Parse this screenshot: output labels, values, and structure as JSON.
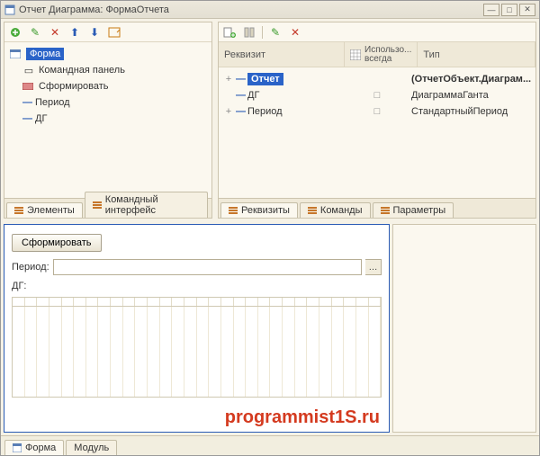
{
  "window": {
    "title": "Отчет Диаграмма: ФормаОтчета"
  },
  "left": {
    "root": "Форма",
    "items": [
      "Командная панель",
      "Сформировать",
      "Период",
      "ДГ"
    ],
    "tabs": {
      "elements": "Элементы",
      "cmd": "Командный интерфейс"
    }
  },
  "right": {
    "cols": {
      "attr": "Реквизит",
      "use": "Использо...\nвсегда",
      "type": "Тип"
    },
    "rows": [
      {
        "name": "Отчет",
        "type": "(ОтчетОбъект.Диаграм...",
        "bold": true,
        "sel": true,
        "exp": "+"
      },
      {
        "name": "ДГ",
        "type": "ДиаграммаГанта",
        "use": "□",
        "exp": ""
      },
      {
        "name": "Период",
        "type": "СтандартныйПериод",
        "use": "□",
        "exp": "+"
      }
    ],
    "tabs": {
      "attrs": "Реквизиты",
      "cmds": "Команды",
      "params": "Параметры"
    }
  },
  "preview": {
    "btn": "Сформировать",
    "period_label": "Период:",
    "dg_label": "ДГ:"
  },
  "footer": {
    "form": "Форма",
    "module": "Модуль"
  },
  "watermark": "programmist1S.ru"
}
